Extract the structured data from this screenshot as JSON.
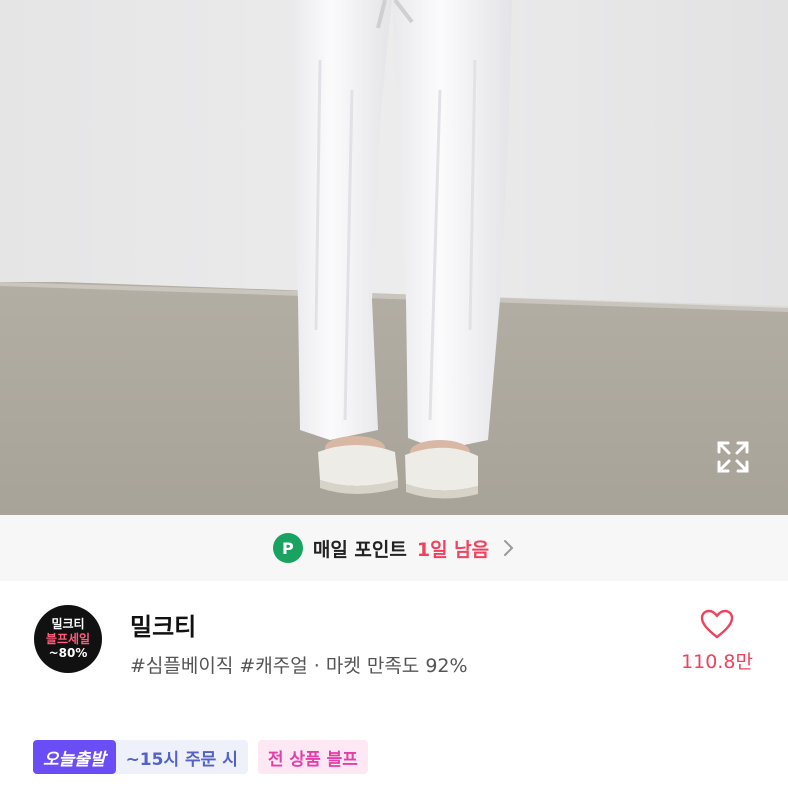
{
  "photo": {
    "alt_name": "product-photo",
    "expand_icon": "expand-icon"
  },
  "point_banner": {
    "badge": "P",
    "label": "매일 포인트",
    "days_left": "1일 남음",
    "chevron_icon": "chevron-right-icon"
  },
  "shop": {
    "logo": {
      "line1": "밀크티",
      "line2": "블프세일",
      "line3": "~80%"
    },
    "name": "밀크티",
    "tags_line": "#심플베이직 #캐주얼 · 마켓 만족도 92%",
    "like_icon": "heart-icon",
    "like_count": "110.8만"
  },
  "badges": {
    "today_ship": "오늘출발",
    "order_time": "~15시 주문 시",
    "sale": "전 상품 블프"
  },
  "colors": {
    "accent_red": "#f0425d",
    "point_green": "#1aa260",
    "today_purple": "#6b4df5",
    "sale_pink": "#e43ea8"
  }
}
